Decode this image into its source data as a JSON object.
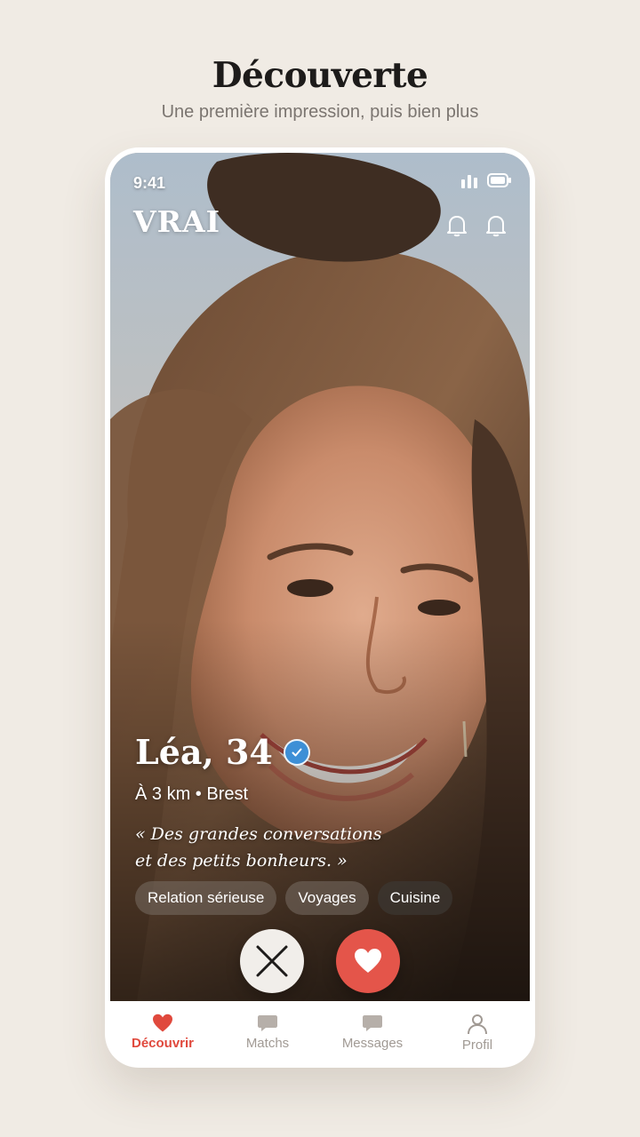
{
  "page": {
    "heading": "Découverte",
    "subheading": "Une première impression, puis bien plus"
  },
  "status_bar": {
    "time": "9:41"
  },
  "app": {
    "logo": "VRAI"
  },
  "top_actions": [
    {
      "icon": "bell-icon"
    },
    {
      "icon": "bell-icon"
    }
  ],
  "profile": {
    "name": "Léa, 34",
    "verified": true,
    "distance": "À 3 km • Brest",
    "quote_line1": "« Des grandes conversations",
    "quote_line2": "et des petits bonheurs. »",
    "tags": [
      "Relation sérieuse",
      "Voyages",
      "Cuisine"
    ]
  },
  "actions": {
    "pass_icon": "close-icon",
    "like_icon": "heart-icon"
  },
  "nav": {
    "items": [
      {
        "label": "Découvrir",
        "icon": "heart-icon",
        "active": true
      },
      {
        "label": "Matchs",
        "icon": "chat-bubble-icon",
        "active": false
      },
      {
        "label": "Messages",
        "icon": "chat-bubble-icon",
        "active": false
      },
      {
        "label": "Profil",
        "icon": "person-icon",
        "active": false
      }
    ]
  },
  "colors": {
    "background": "#f0ebe4",
    "accent": "#e4554a",
    "active_nav": "#e0493d",
    "verified": "#3d8fd6"
  }
}
